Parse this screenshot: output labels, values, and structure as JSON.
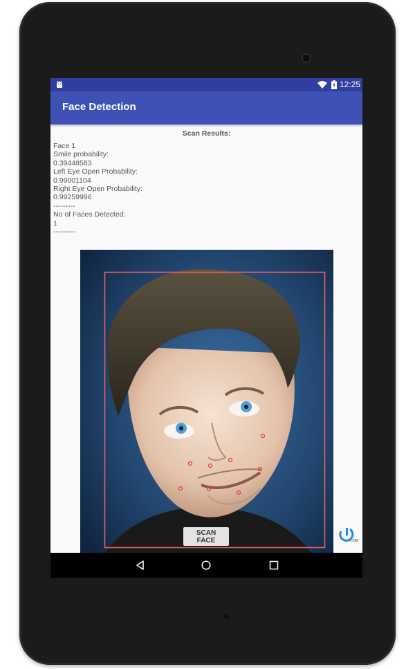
{
  "status_bar": {
    "time": "12:25",
    "icons": [
      "android-icon",
      "wifi-icon",
      "battery-icon"
    ]
  },
  "app_bar": {
    "title": "Face Detection",
    "color": "#3F51B5",
    "status_color": "#303F9F"
  },
  "results": {
    "title": "Scan Results:",
    "lines": [
      "Face 1",
      "Smile probability:",
      "0.39448583",
      "Left Eye Open Probability:",
      "0.99001104",
      "Right Eye Open Probability:",
      "0.99259996",
      "---------",
      "No of Faces Detected:",
      "1",
      "---------"
    ]
  },
  "face_overlay": {
    "box_color": "#e8625f",
    "landmark_color": "#e53935",
    "landmark_count": 8
  },
  "scan_button": {
    "label": "SCAN FACE"
  },
  "watermark": {
    "text": ".COM"
  },
  "nav_bar": {
    "buttons": [
      "back-icon",
      "home-icon",
      "recent-apps-icon"
    ]
  }
}
